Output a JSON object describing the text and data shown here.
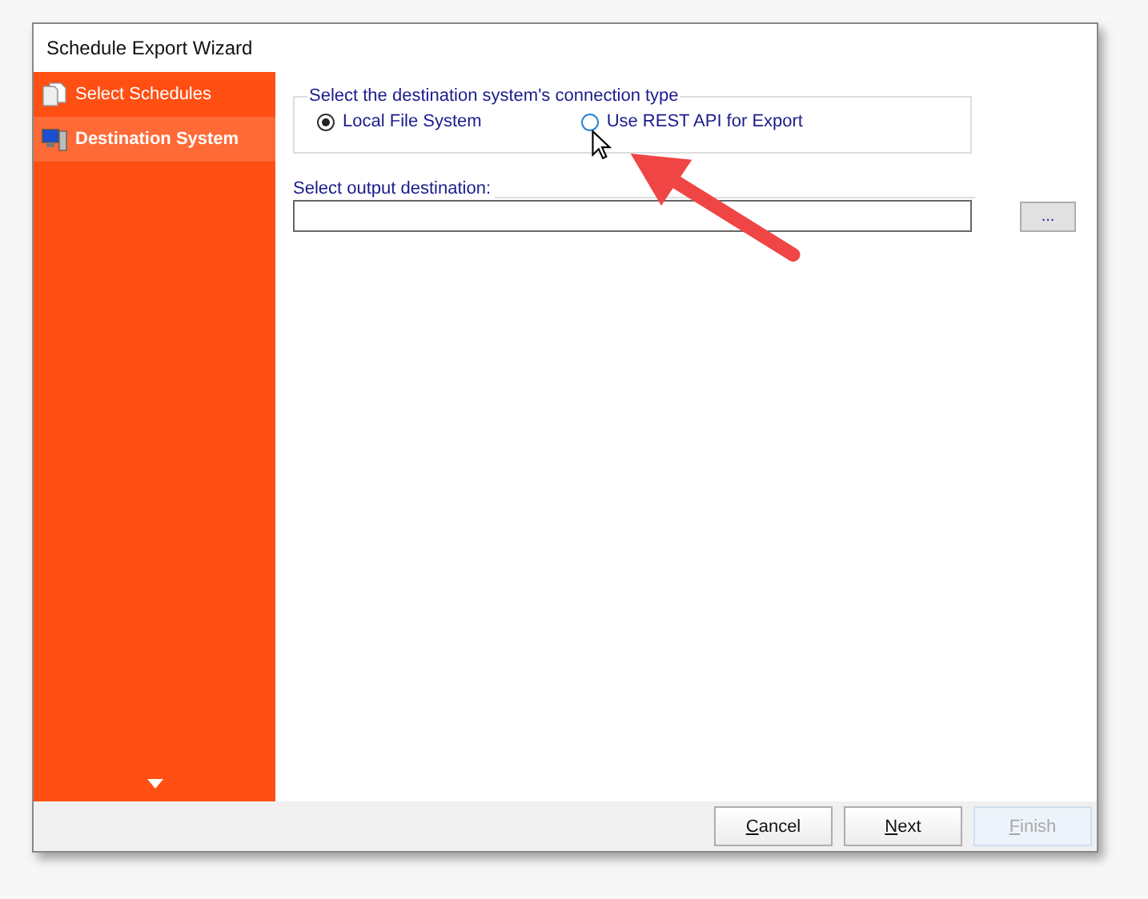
{
  "window": {
    "title": "Schedule Export Wizard"
  },
  "sidebar": {
    "items": [
      {
        "label": "Select Schedules",
        "kind": "pages",
        "selected": false
      },
      {
        "label": "Destination System",
        "kind": "computer",
        "selected": true
      }
    ]
  },
  "connection_type": {
    "legend": "Select the destination system's connection type",
    "options": [
      {
        "label": "Local File System",
        "selected": true
      },
      {
        "label": "Use REST API for Export",
        "selected": false
      }
    ]
  },
  "output": {
    "label": "Select output destination:",
    "browse": "..."
  },
  "buttons": [
    {
      "access_key": "C",
      "label_rest": "ancel",
      "disabled": false
    },
    {
      "access_key": "N",
      "label_rest": "ext",
      "disabled": false
    },
    {
      "access_key": "F",
      "label_rest": "inish",
      "disabled": true
    }
  ]
}
